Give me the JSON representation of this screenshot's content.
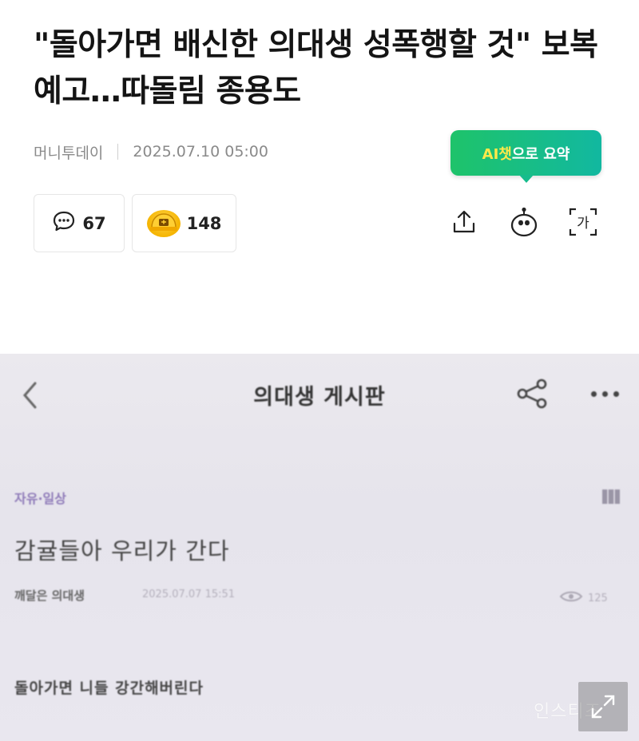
{
  "article": {
    "headline": "\"돌아가면 배신한 의대생 성폭행할 것\" 보복 예고…따돌림 종용도",
    "source": "머니투데이",
    "datetime": "2025.07.10 05:00"
  },
  "ai_summary": {
    "highlight": "AI챗",
    "rest": "으로 요약"
  },
  "reactions": {
    "comments_count": "67",
    "emoji_count": "148"
  },
  "icons": {
    "comment": "speech-bubble-icon",
    "emoji": "helmet-emoji-icon",
    "share": "share-upload-icon",
    "ai_bot": "robot-icon",
    "text_size": "text-size-icon"
  },
  "photo": {
    "board_title": "의대생 게시판",
    "category": "자유·일상",
    "post_title": "감귤들아 우리가 간다",
    "author": "깨달은 의대생",
    "date": "2025.07.07 15:51",
    "views": "125",
    "body": "돌아가면 니들 강간해버린다",
    "watermark": "인스티즈"
  },
  "colors": {
    "ai_gradient_start": "#1ec36a",
    "ai_gradient_end": "#12b8a0",
    "ai_highlight": "#ffe94a",
    "category": "#8e7ab8"
  }
}
